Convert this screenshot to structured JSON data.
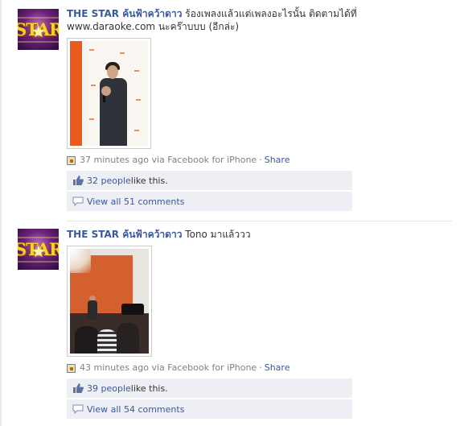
{
  "posts": [
    {
      "avatar_text": "STAR",
      "author": "THE STAR ค้นฟ้าคว้าดาว",
      "message": "ร้องเพลงแล้วแต่เพลงอะไรนั้น ติดตามได้ที่ www.daraoke.com นะคร๊าบบบ (อีกล่ะ)",
      "time": "37 minutes ago via Facebook for iPhone",
      "separator": "·",
      "share": "Share",
      "likes_link": "32 people",
      "likes_suffix": " like this.",
      "comments": "View all 51 comments"
    },
    {
      "avatar_text": "STAR",
      "author": "THE STAR ค้นฟ้าคว้าดาว",
      "message": "Tono มาแล้ววว",
      "time": "43 minutes ago via Facebook for iPhone",
      "separator": "·",
      "share": "Share",
      "likes_link": "39 people",
      "likes_suffix": " like this.",
      "comments": "View all 54 comments"
    }
  ],
  "icons": {
    "mobile": "mobile-upload-icon",
    "like": "thumbs-up-icon",
    "comment": "comment-bubble-icon"
  },
  "colors": {
    "link": "#3b5998",
    "meta_text": "#808080",
    "ufi_bg": "#edeff4"
  }
}
